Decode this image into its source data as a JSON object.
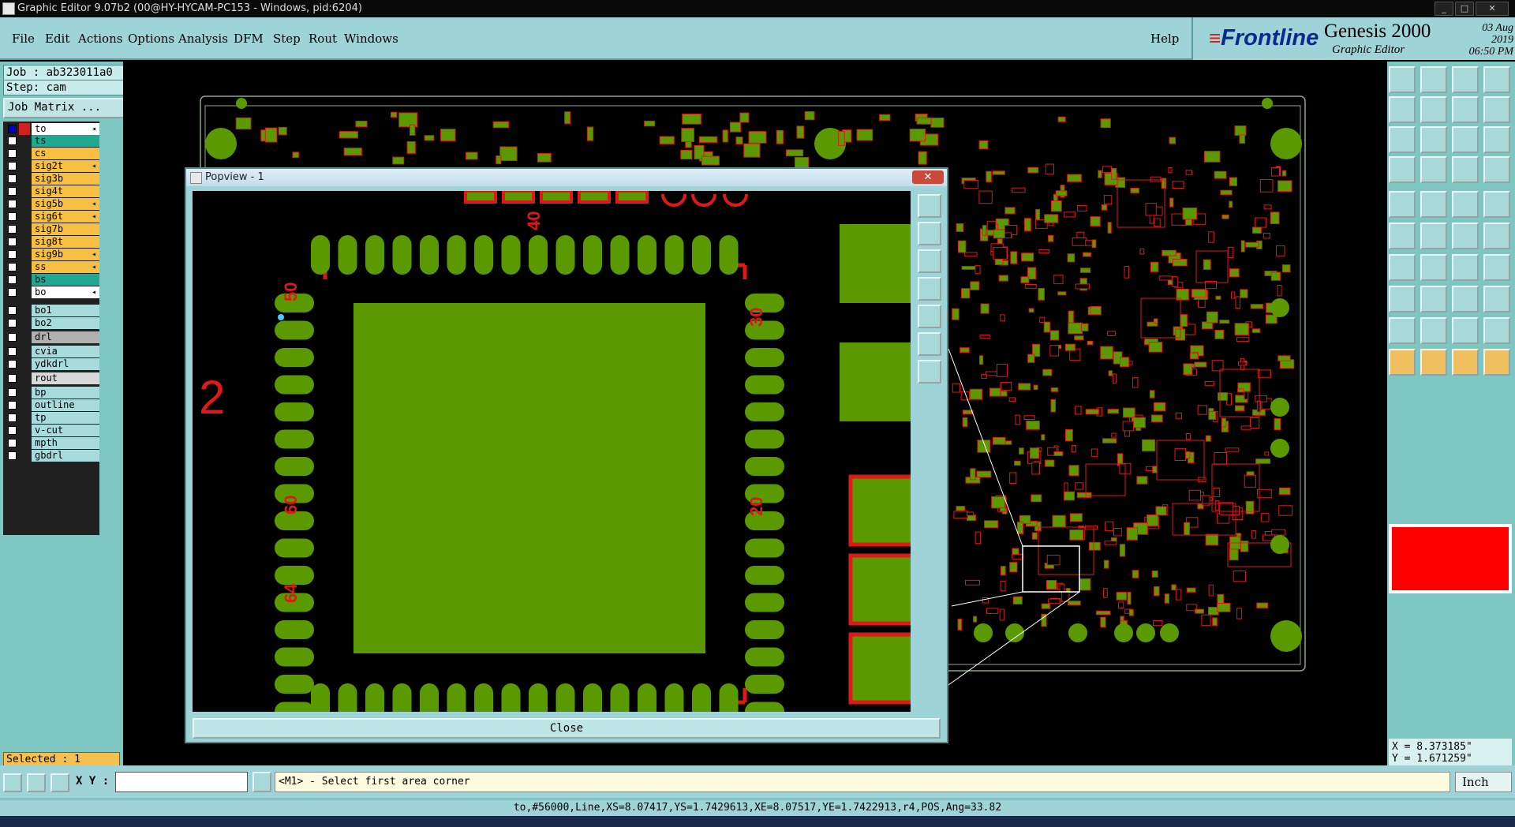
{
  "window": {
    "title": "Graphic Editor 9.07b2 (00@HY-HYCAM-PC153 - Windows, pid:6204)"
  },
  "menu": {
    "file": "File",
    "edit": "Edit",
    "actions": "Actions",
    "options": "Options",
    "analysis": "Analysis",
    "dfm": "DFM",
    "step": "Step",
    "rout": "Rout",
    "windows": "Windows",
    "help": "Help"
  },
  "brand": {
    "logo": "Frontline",
    "product": "Genesis 2000",
    "subtitle": "Graphic Editor",
    "date": "03 Aug 2019",
    "time": "06:50 PM"
  },
  "left": {
    "job": "Job : ab323011a0",
    "step": "Step: cam",
    "job_matrix": "Job Matrix ...",
    "selected": "Selected : 1",
    "layers": [
      {
        "name": "to",
        "color": "#ffffff",
        "arrow": "◂"
      },
      {
        "name": "ts",
        "color": "#20a890",
        "arrow": ""
      },
      {
        "name": "cs",
        "color": "#f8c040",
        "arrow": ""
      },
      {
        "name": "sig2t",
        "color": "#f8c040",
        "arrow": "◂"
      },
      {
        "name": "sig3b",
        "color": "#f8c040",
        "arrow": ""
      },
      {
        "name": "sig4t",
        "color": "#f8c040",
        "arrow": ""
      },
      {
        "name": "sig5b",
        "color": "#f8c040",
        "arrow": "◂"
      },
      {
        "name": "sig6t",
        "color": "#f8c040",
        "arrow": "◂"
      },
      {
        "name": "sig7b",
        "color": "#f8c040",
        "arrow": ""
      },
      {
        "name": "sig8t",
        "color": "#f8c040",
        "arrow": ""
      },
      {
        "name": "sig9b",
        "color": "#f8c040",
        "arrow": "◂"
      },
      {
        "name": "ss",
        "color": "#f8c040",
        "arrow": "◂"
      },
      {
        "name": "bs",
        "color": "#20a890",
        "arrow": ""
      },
      {
        "name": "bo",
        "color": "#ffffff",
        "arrow": "◂"
      },
      {
        "name": "bo1",
        "color": "#a8dcdc",
        "arrow": ""
      },
      {
        "name": "bo2",
        "color": "#a8dcdc",
        "arrow": ""
      },
      {
        "name": "drl",
        "color": "#b0b0b0",
        "arrow": ""
      },
      {
        "name": "cvia",
        "color": "#a8dcdc",
        "arrow": ""
      },
      {
        "name": "ydkdrl",
        "color": "#a8dcdc",
        "arrow": ""
      },
      {
        "name": "rout",
        "color": "#d8d8d8",
        "arrow": ""
      },
      {
        "name": "bp",
        "color": "#a8dcdc",
        "arrow": ""
      },
      {
        "name": "outline",
        "color": "#a8dcdc",
        "arrow": ""
      },
      {
        "name": "tp",
        "color": "#a8dcdc",
        "arrow": ""
      },
      {
        "name": "v-cut",
        "color": "#a8dcdc",
        "arrow": ""
      },
      {
        "name": "mpth",
        "color": "#a8dcdc",
        "arrow": ""
      },
      {
        "name": "gbdrl",
        "color": "#a8dcdc",
        "arrow": ""
      }
    ]
  },
  "popview": {
    "title": "Popview - 1",
    "close": "Close",
    "labels": {
      "pin40": "40",
      "pin30": "30",
      "pin50": "50",
      "pin20": "20",
      "pin60": "60",
      "pin64": "64",
      "side": "2"
    }
  },
  "coords": {
    "x": "X = 8.373185\"",
    "y": "Y = 1.671259\""
  },
  "prompt": {
    "xy_label": "X Y :",
    "message": "<M1> - Select first area corner",
    "unit": "Inch"
  },
  "status": "to,#56000,Line,XS=8.07417,YS=1.7429613,XE=8.07517,YE=1.7422913,r4,POS,Ang=33.82",
  "colors": {
    "pcb_red": "#e01818",
    "pcb_green": "#5a9a00",
    "panel_teal": "#9ed4d8"
  }
}
